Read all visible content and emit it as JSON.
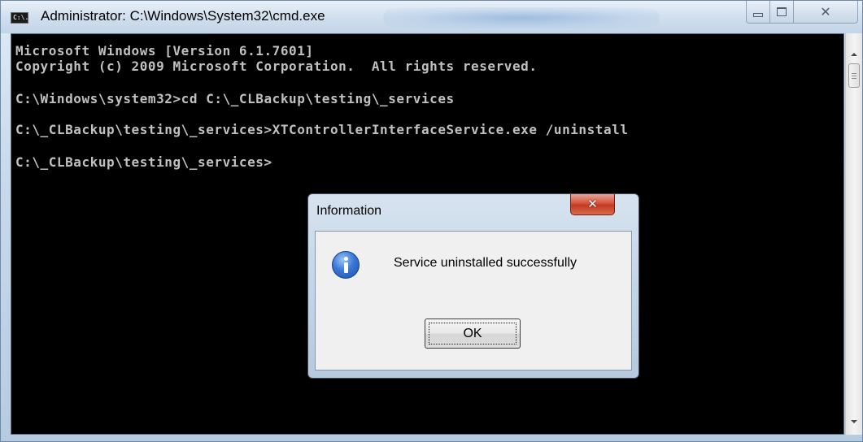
{
  "window": {
    "title": "Administrator: C:\\Windows\\System32\\cmd.exe",
    "icon": "cmd-icon",
    "icon_text": "C:\\.",
    "buttons": {
      "minimize_icon": "minimize-icon",
      "maximize_icon": "maximize-icon",
      "close_icon": "close-icon",
      "close_glyph": "✕"
    }
  },
  "console": {
    "background": "#000000",
    "text_color": "#c0c0c0",
    "lines": [
      "Microsoft Windows [Version 6.1.7601]",
      "Copyright (c) 2009 Microsoft Corporation.  All rights reserved.",
      "C:\\Windows\\system32>cd C:\\_CLBackup\\testing\\_services",
      "C:\\_CLBackup\\testing\\_services>XTControllerInterfaceService.exe /uninstall",
      "C:\\_CLBackup\\testing\\_services>"
    ]
  },
  "scrollbar": {
    "up_icon": "scroll-up-arrow-icon",
    "down_icon": "scroll-down-arrow-icon"
  },
  "dialog": {
    "title": "Information",
    "close_glyph": "✕",
    "icon": "information-icon",
    "message": "Service uninstalled successfully",
    "ok_label": "OK",
    "close_button_color": "#c23a22",
    "info_icon_color": "#3a78d6"
  }
}
